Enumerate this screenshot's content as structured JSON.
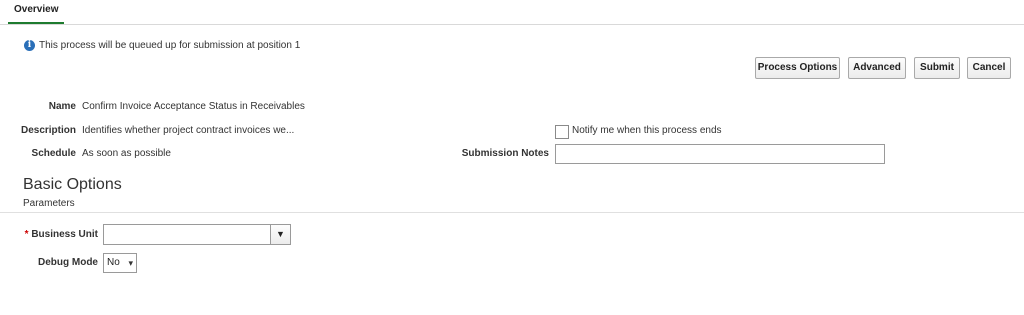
{
  "tabs": {
    "overview": "Overview"
  },
  "info": {
    "icon": "info-icon",
    "message": "This process will be queued up for submission at position 1"
  },
  "buttons": {
    "process_options": "Process Options",
    "advanced": "Advanced",
    "submit": "Submit",
    "cancel": "Cancel"
  },
  "form": {
    "name_label": "Name",
    "name_value": "Confirm Invoice Acceptance Status in Receivables",
    "description_label": "Description",
    "description_value": "Identifies whether project contract invoices we...",
    "schedule_label": "Schedule",
    "schedule_value": "As soon as possible",
    "notify_label": "Notify me when this process ends",
    "notify_checked": false,
    "notes_label": "Submission Notes",
    "notes_value": ""
  },
  "basic_options": {
    "title": "Basic Options",
    "parameters_label": "Parameters",
    "required_marker": "*",
    "business_unit_label": "Business Unit",
    "business_unit_value": "",
    "debug_mode_label": "Debug Mode",
    "debug_mode_value": "No"
  }
}
